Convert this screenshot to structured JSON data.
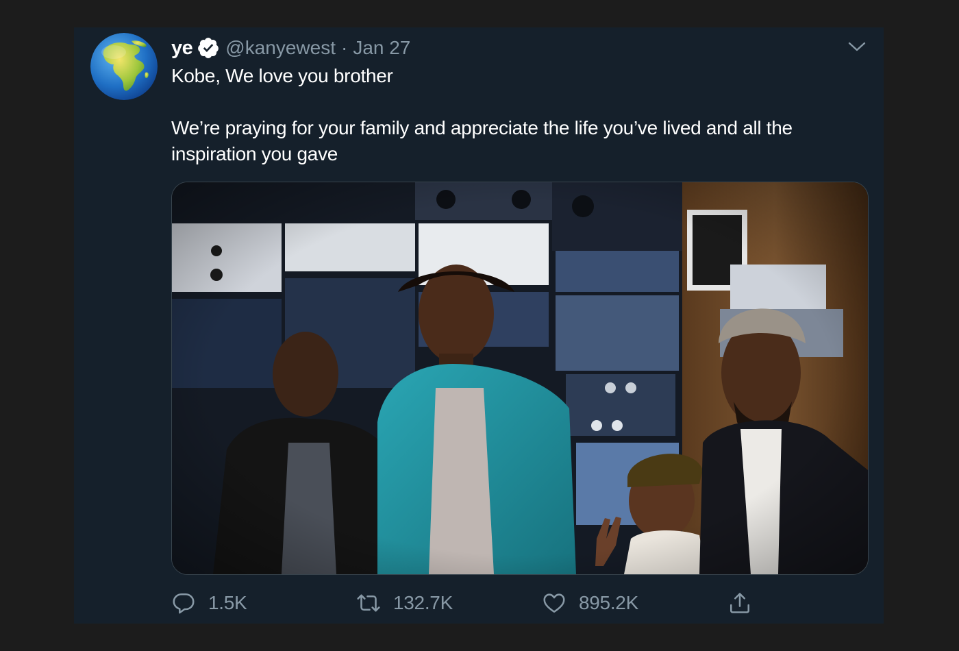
{
  "tweet": {
    "display_name": "ye",
    "handle": "@kanyewest",
    "separator": "·",
    "date": "Jan 27",
    "text_line1": "Kobe, We love you brother",
    "text_line2": "We’re praying for your family and appreciate the life you’ve lived and all the inspiration you gave",
    "avatar_icon": "globe-africa-icon",
    "verified_icon": "verified-badge-icon"
  },
  "actions": {
    "replies": "1.5K",
    "retweets": "132.7K",
    "likes": "895.2K"
  },
  "colors": {
    "background": "#15202b",
    "page": "#1c1c1c",
    "text": "#ffffff",
    "secondary": "#8899a6",
    "border": "#38444d"
  }
}
